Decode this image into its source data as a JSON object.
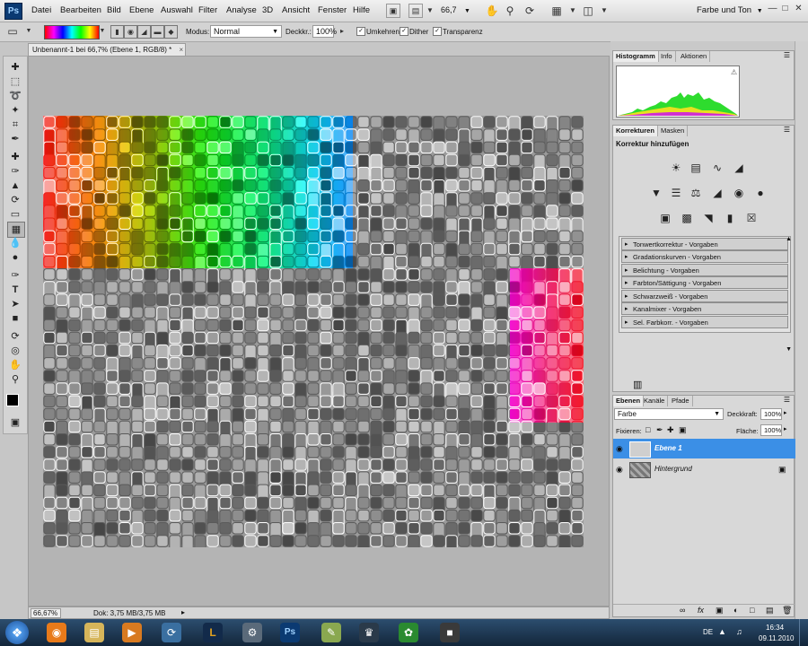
{
  "app": {
    "logo": "Ps"
  },
  "menu": [
    "Datei",
    "Bearbeiten",
    "Bild",
    "Ebene",
    "Auswahl",
    "Filter",
    "Analyse",
    "3D",
    "Ansicht",
    "Fenster",
    "Hilfe"
  ],
  "appbar": {
    "zoom": "66,7",
    "workspace": "Farbe und Ton"
  },
  "options": {
    "mode_label": "Modus:",
    "mode_value": "Normal",
    "opacity_label": "Deckkr.:",
    "opacity_value": "100%",
    "checkboxes": [
      "Umkehren",
      "Dither",
      "Transparenz"
    ]
  },
  "document": {
    "tab_title": "Unbenannt-1 bei 66,7% (Ebene 1, RGB/8) *",
    "close_glyph": "×"
  },
  "status": {
    "zoom": "66,67%",
    "doc_info": "Dok: 3,75 MB/3,75 MB"
  },
  "histogram_panel": {
    "tabs": [
      "Histogramm",
      "Info",
      "Aktionen"
    ]
  },
  "corrections_panel": {
    "tabs": [
      "Korrekturen",
      "Masken"
    ],
    "heading": "Korrektur hinzufügen",
    "presets": [
      "Tonwertkorrektur - Vorgaben",
      "Gradationskurven - Vorgaben",
      "Belichtung - Vorgaben",
      "Farbton/Sättigung - Vorgaben",
      "Schwarzweiß - Vorgaben",
      "Kanalmixer - Vorgaben",
      "Sel. Farbkorr. - Vorgaben"
    ]
  },
  "layers_panel": {
    "tabs": [
      "Ebenen",
      "Kanäle",
      "Pfade"
    ],
    "blend_mode": "Farbe",
    "opacity_label": "Deckkraft:",
    "opacity_value": "100%",
    "lock_label": "Fixieren:",
    "fill_label": "Fläche:",
    "fill_value": "100%",
    "layers": [
      {
        "name": "Ebene 1",
        "selected": true
      },
      {
        "name": "Hintergrund",
        "selected": false,
        "locked": true
      }
    ]
  },
  "taskbar": {
    "time": "16:34",
    "date": "09.11.2010",
    "language": "DE"
  },
  "colors": {
    "selection_blue": "#3b8fe6",
    "ps_blue": "#0b3a72"
  }
}
